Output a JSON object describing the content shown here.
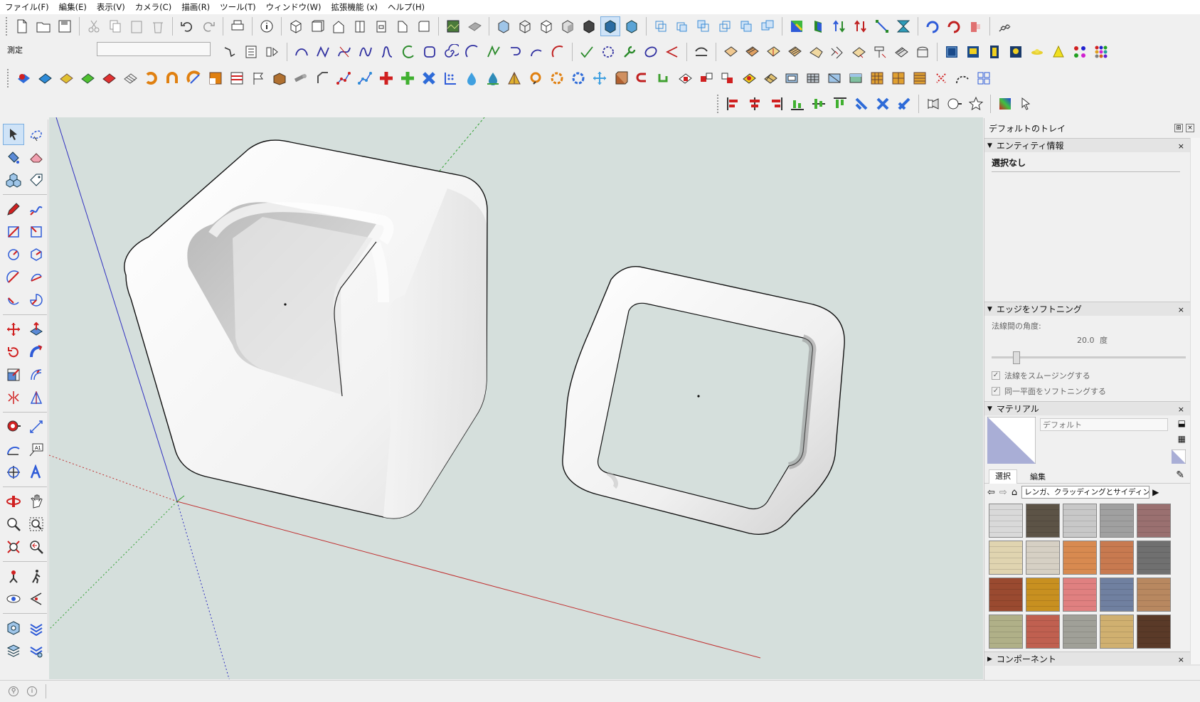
{
  "menu": [
    "ファイル(F)",
    "編集(E)",
    "表示(V)",
    "カメラ(C)",
    "描画(R)",
    "ツール(T)",
    "ウィンドウ(W)",
    "拡張機能 (x)",
    "ヘルプ(H)"
  ],
  "measure": {
    "label": "測定",
    "value": ""
  },
  "tray": {
    "title": "デフォルトのトレイ",
    "entity_info": {
      "header": "エンティティ情報",
      "selection": "選択なし"
    },
    "soften": {
      "header": "エッジをソフトニング",
      "angle_label": "法線間の角度:",
      "angle_value": "20.0",
      "angle_unit": "度",
      "smooth_normals": "法線をスムージングする",
      "soften_coplanar": "同一平面をソフトニングする"
    },
    "materials": {
      "header": "マテリアル",
      "name": "デフォルト",
      "tab_select": "選択",
      "tab_edit": "編集",
      "collection": "レンガ、クラッディングとサイディング"
    },
    "components": {
      "header": "コンポーネント"
    }
  },
  "colors": {
    "viewport_bg": "#d5dfdc",
    "axis_red": "#d03030",
    "axis_green": "#30a030",
    "axis_blue": "#3030c0",
    "default_material": "#a9aed6"
  },
  "swatches": [
    "#d9d9d9",
    "#5c5346",
    "#c8c8c8",
    "#a0a0a0",
    "#9a7070",
    "#e0d4b0",
    "#d6d0c4",
    "#d88a50",
    "#c87a50",
    "#707070",
    "#9a4a30",
    "#c89020",
    "#e08080",
    "#7080a0",
    "#b88860",
    "#b0b088",
    "#c06050",
    "#a0a098",
    "#d0b070",
    "#5a3a28"
  ]
}
